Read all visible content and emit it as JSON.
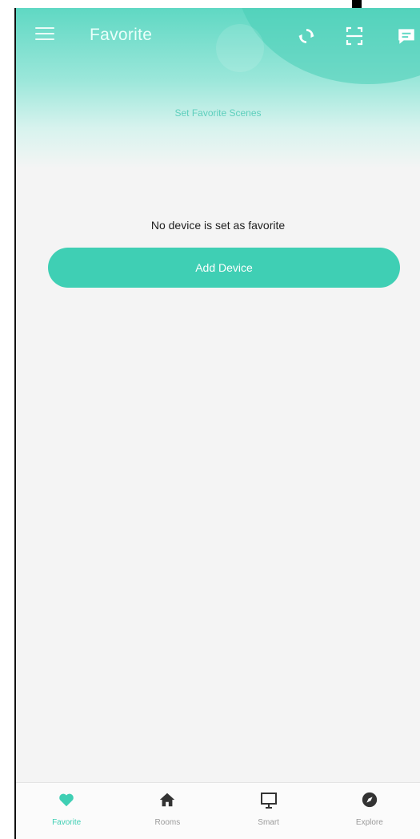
{
  "header": {
    "title": "Favorite",
    "icons": [
      "menu-icon",
      "sync-icon",
      "scan-icon",
      "message-icon"
    ]
  },
  "scenes": {
    "link_label": "Set Favorite Scenes"
  },
  "empty_state": {
    "message": "No device is set as favorite",
    "button_label": "Add Device"
  },
  "bottom_nav": {
    "items": [
      {
        "label": "Favorite",
        "icon": "heart-icon",
        "active": true
      },
      {
        "label": "Rooms",
        "icon": "home-icon",
        "active": false
      },
      {
        "label": "Smart",
        "icon": "monitor-icon",
        "active": false
      },
      {
        "label": "Explore",
        "icon": "compass-icon",
        "active": false
      }
    ]
  },
  "colors": {
    "accent": "#3fcfb4",
    "header_gradient_top": "#5fd8c3",
    "background": "#f4f4f4",
    "inactive_nav": "#9a9a9a"
  }
}
